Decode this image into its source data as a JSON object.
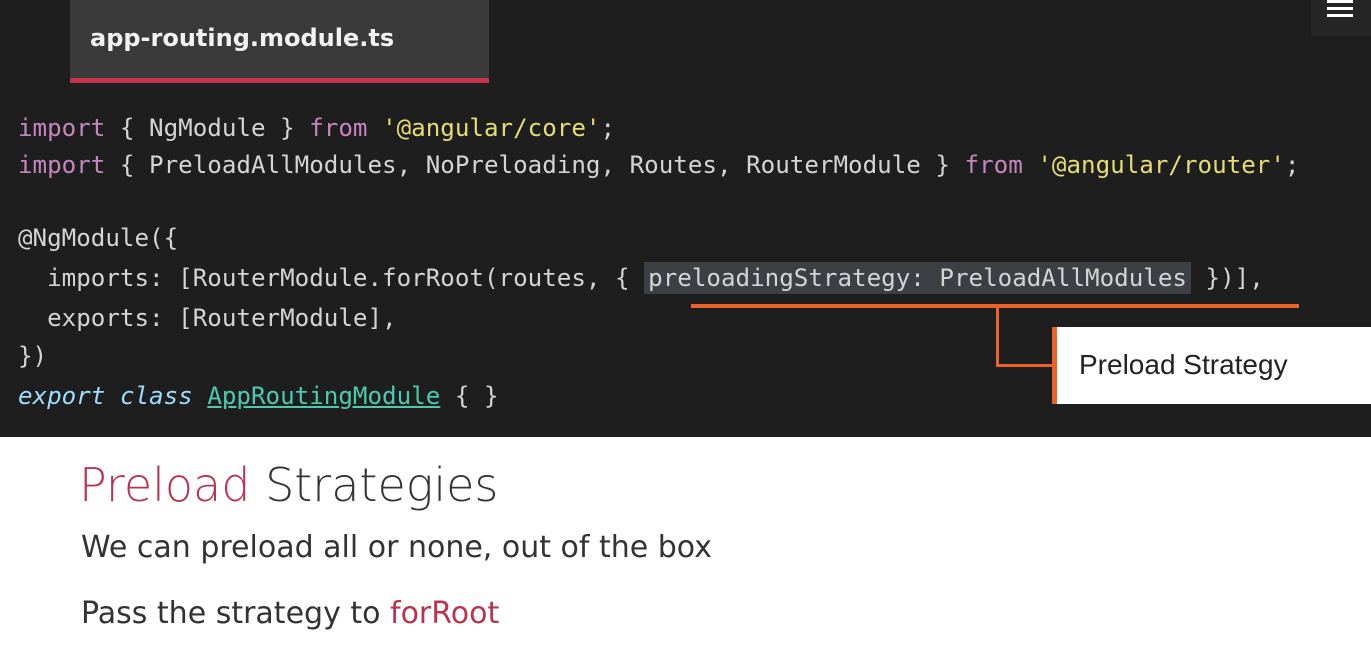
{
  "file_tab": {
    "label": "app-routing.module.ts"
  },
  "menu_icon": "hamburger-menu-icon",
  "code": {
    "line1": {
      "kw1": "import",
      "p1": " { NgModule } ",
      "kw2": "from",
      "p2": " ",
      "str": "'@angular/core'",
      "p3": ";"
    },
    "line2": {
      "kw1": "import",
      "p1": " { PreloadAllModules, NoPreloading, Routes, RouterModule } ",
      "kw2": "from",
      "p2": " ",
      "str": "'@angular/router'",
      "p3": ";"
    },
    "line4": "@NgModule({",
    "line5": {
      "pre": "  imports: [RouterModule.forRoot(routes, { ",
      "hl": "preloadingStrategy: PreloadAllModules",
      "post": " })],"
    },
    "line6": "  exports: [RouterModule],",
    "line7": "})",
    "line8": {
      "kw1": "export",
      "kw2": "class",
      "cls": "AppRoutingModule",
      "post": " { }"
    }
  },
  "callout": {
    "label": "Preload Strategy"
  },
  "slide": {
    "heading_accent": "Preload",
    "heading_rest": " Strategies",
    "bullet1": "We can preload all or none, out of the box",
    "bullet2_pre": "Pass the strategy to ",
    "bullet2_accent": "forRoot"
  },
  "colors": {
    "accent": "#b8354f",
    "callout": "#e8622a",
    "code_bg": "#1e1e1e"
  }
}
